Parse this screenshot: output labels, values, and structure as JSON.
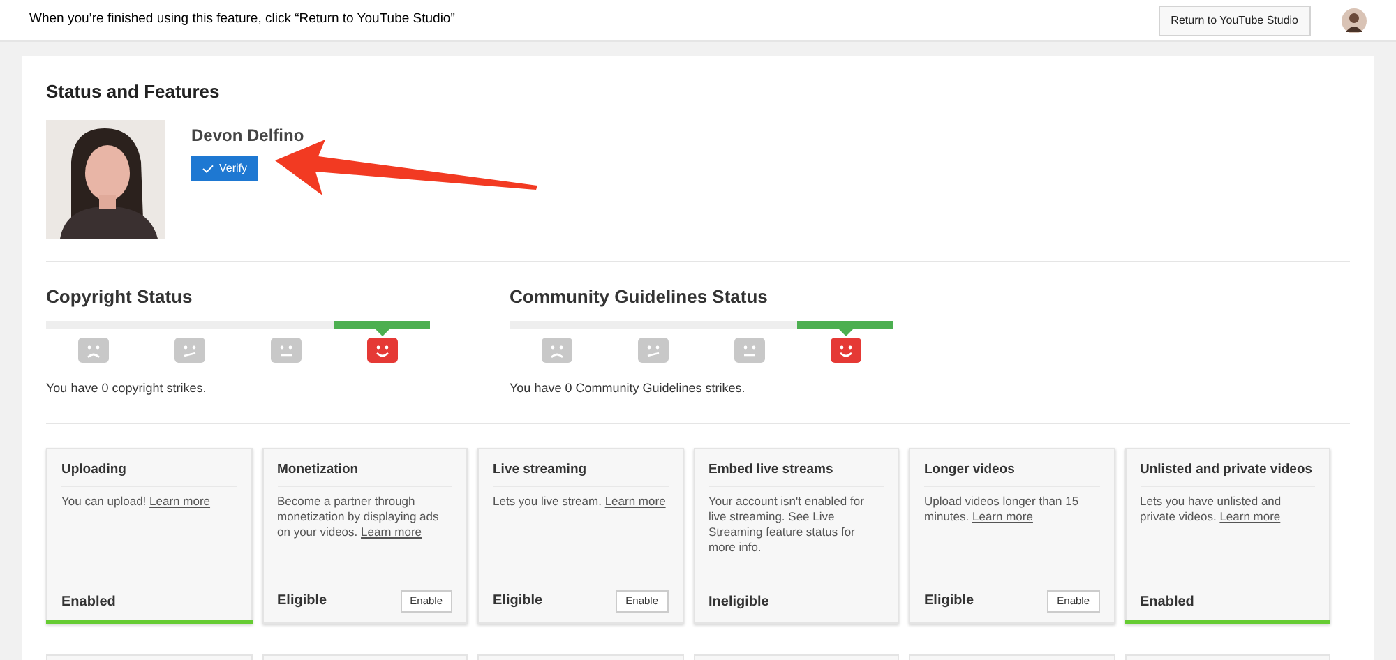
{
  "top_bar": {
    "notice": "When you’re finished using this feature, click “Return to YouTube Studio”",
    "return_button": "Return to YouTube Studio"
  },
  "title": "Status and Features",
  "profile": {
    "name": "Devon Delfino",
    "verify_button": "Verify"
  },
  "statuses": [
    {
      "title": "Copyright Status",
      "faces": [
        {
          "kind": "sad",
          "selected": false
        },
        {
          "kind": "worried",
          "selected": false
        },
        {
          "kind": "neutral",
          "selected": false
        },
        {
          "kind": "happy",
          "selected": true
        }
      ],
      "note": "You have 0 copyright strikes."
    },
    {
      "title": "Community Guidelines Status",
      "faces": [
        {
          "kind": "sad",
          "selected": false
        },
        {
          "kind": "worried",
          "selected": false
        },
        {
          "kind": "neutral",
          "selected": false
        },
        {
          "kind": "happy",
          "selected": true
        }
      ],
      "note": "You have 0 Community Guidelines strikes."
    }
  ],
  "features": [
    {
      "title": "Uploading",
      "description": "You can upload!",
      "link": "Learn more",
      "status": "Enabled",
      "kind": "enabled"
    },
    {
      "title": "Monetization",
      "description": "Become a partner through monetization by displaying ads on your videos.",
      "link": "Learn more",
      "status": "Eligible",
      "kind": "eligible",
      "button": "Enable"
    },
    {
      "title": "Live streaming",
      "description": "Lets you live stream.",
      "link": "Learn more",
      "status": "Eligible",
      "kind": "eligible",
      "button": "Enable"
    },
    {
      "title": "Embed live streams",
      "description": "Your account isn't enabled for live streaming. See Live Streaming feature status for more info.",
      "status": "Ineligible",
      "kind": "ineligible"
    },
    {
      "title": "Longer videos",
      "description": "Upload videos longer than 15 minutes.",
      "link": "Learn more",
      "status": "Eligible",
      "kind": "eligible",
      "button": "Enable"
    },
    {
      "title": "Unlisted and private videos",
      "description": "Lets you have unlisted and private videos.",
      "link": "Learn more",
      "status": "Enabled",
      "kind": "enabled"
    }
  ]
}
